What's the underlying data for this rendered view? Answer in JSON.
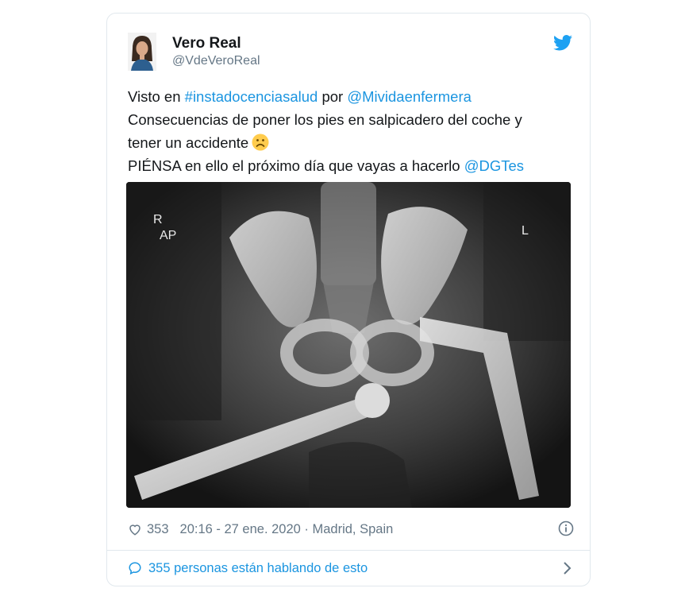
{
  "tweet": {
    "author_name": "Vero Real",
    "author_handle": "@VdeVeroReal",
    "line1_prefix": "Visto en ",
    "hashtag": "#instadocenciasalud",
    "line1_mid": " por ",
    "mention1": "@Mividaenfermera",
    "line2": "Consecuencias de poner los pies en salpicadero del coche y",
    "line3": "tener un accidente",
    "line4_prefix": "PIÉNSA en ello el próximo día que vayas a hacerlo ",
    "mention2": "@DGTes",
    "xray_label_side_left": "R",
    "xray_label_view": "AP",
    "xray_label_side_right": "L",
    "likes": "353",
    "meta": "20:16 - 27 ene. 2020 · Madrid, Spain",
    "conversation": "355 personas están hablando de esto"
  },
  "colors": {
    "link": "#1b95e0",
    "secondary": "#657786",
    "border": "#e1e8ed"
  },
  "icons": [
    "avatar",
    "twitter-bird-icon",
    "sad-face-emoji-icon",
    "heart-icon",
    "info-icon",
    "speech-bubble-icon",
    "chevron-right-icon"
  ]
}
